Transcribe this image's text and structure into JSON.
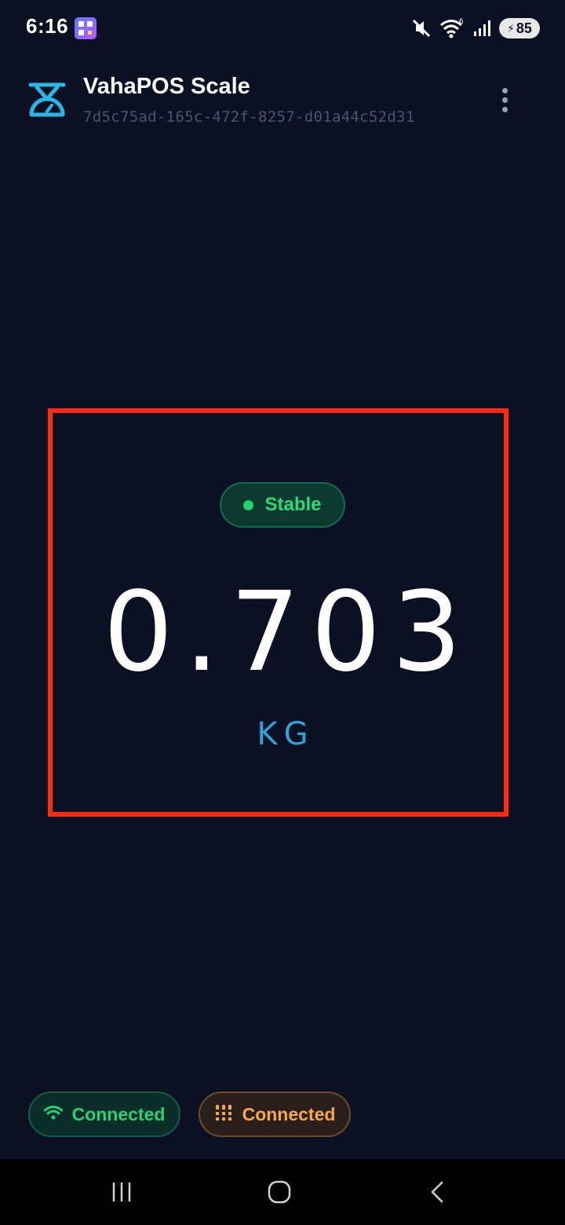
{
  "status_bar": {
    "time": "6:16",
    "battery_level": "85",
    "icons": [
      "qr-app-icon",
      "mute-icon",
      "wifi-6-icon",
      "signal-icon",
      "battery-charging-icon"
    ]
  },
  "header": {
    "title": "VahaPOS Scale",
    "device_id": "7d5c75ad-165c-472f-8257-d01a44c52d31",
    "logo_icon": "scale-icon",
    "menu_icon": "more-vert-icon"
  },
  "weight": {
    "status_label": "Stable",
    "value": "0.703",
    "unit": "KG"
  },
  "connections": {
    "wifi_label": "Connected",
    "scale_label": "Connected",
    "wifi_icon": "wifi-icon",
    "scale_icon": "scale-bars-icon"
  },
  "nav_bar": {
    "icons": [
      "recents-icon",
      "home-icon",
      "back-icon"
    ]
  },
  "colors": {
    "background": "#0b1022",
    "accent_blue": "#2ea3db",
    "stable_green": "#29dc78",
    "scale_orange": "#f6a94a",
    "highlight_frame": "#ff2a14"
  }
}
